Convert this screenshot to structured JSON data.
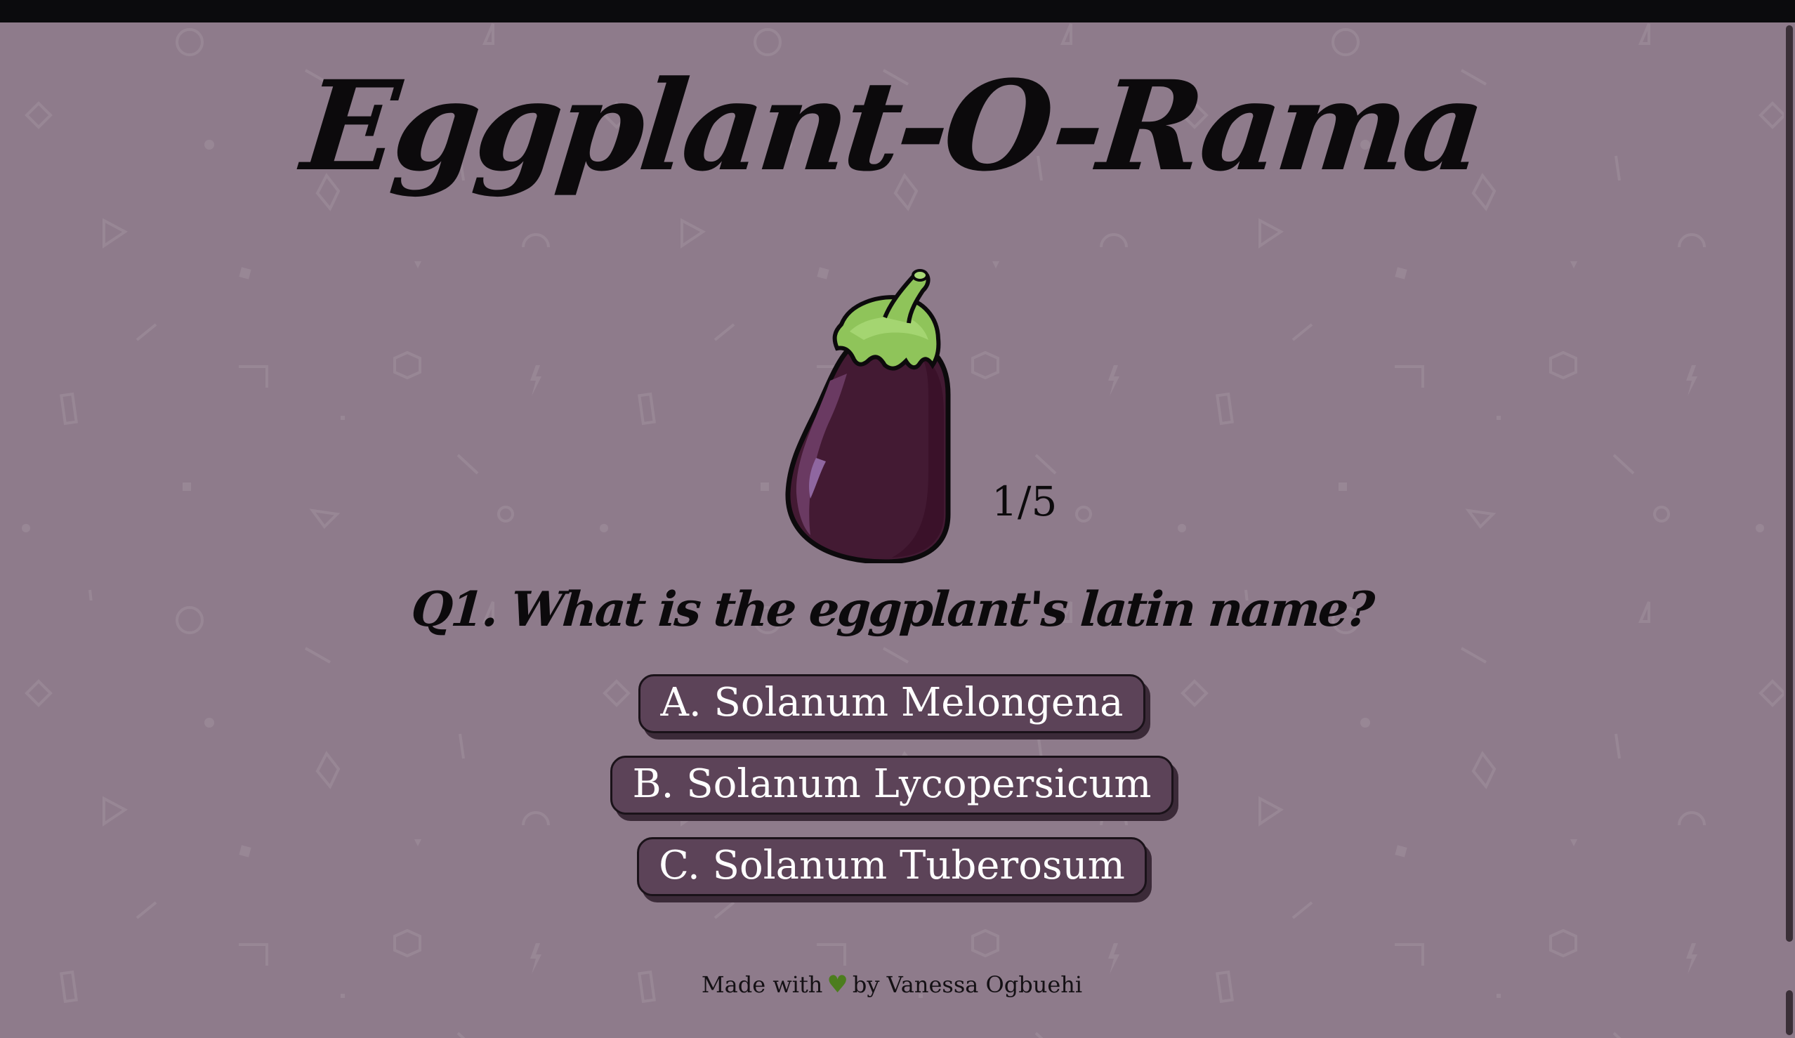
{
  "app": {
    "title": "Eggplant-O-Rama"
  },
  "quiz": {
    "progress": "1/5",
    "question": "Q1. What is the eggplant's latin name?",
    "answers": [
      {
        "label": "A. Solanum Melongena"
      },
      {
        "label": "B. Solanum Lycopersicum"
      },
      {
        "label": "C. Solanum Tuberosum"
      }
    ]
  },
  "footer": {
    "made_with": "Made with",
    "heart_icon": "heart-icon",
    "by": "by Vanessa Ogbuehi"
  },
  "colors": {
    "background": "#8e7b8b",
    "button": "#5c4358",
    "button_shadow": "#3b2a38",
    "text": "#0c0a0c",
    "heart": "#4c7d1e",
    "eggplant": "#431a33",
    "stem": "#8fc45a"
  }
}
